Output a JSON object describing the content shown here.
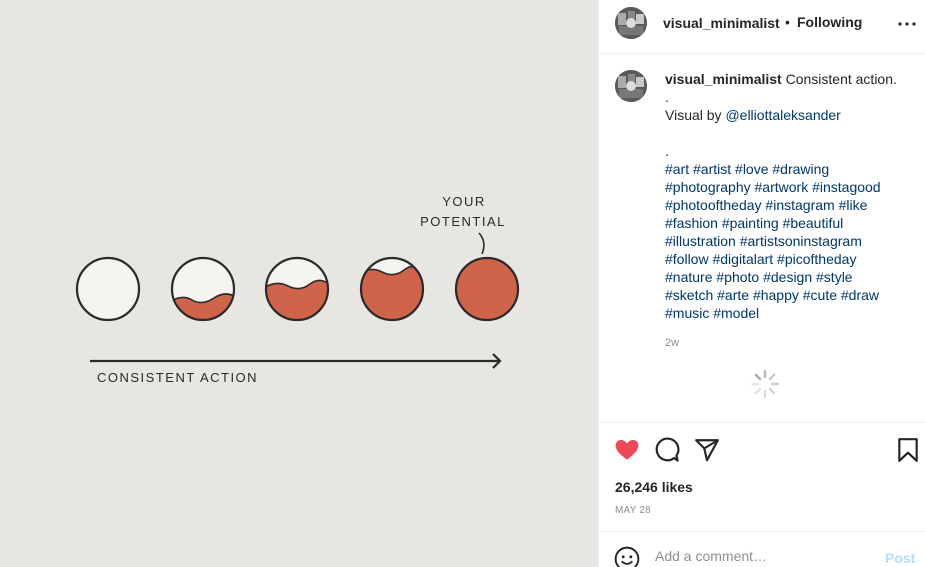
{
  "image": {
    "label_top_line1": "YOUR",
    "label_top_line2": "POTENTIAL",
    "label_bottom": "CONSISTENT ACTION",
    "background_color": "#e8e6e0",
    "fill_color": "#d0644a",
    "stroke_color": "#2a2a2a",
    "circle_fill_levels": [
      0,
      0.32,
      0.5,
      0.75,
      1.0
    ]
  },
  "header": {
    "username": "visual_minimalist",
    "separator": "•",
    "follow_label": "Following",
    "more_icon": "more-options-icon"
  },
  "caption": {
    "username": "visual_minimalist",
    "text": "Consistent action.",
    "line_dot1": ".",
    "credit_prefix": "Visual by ",
    "credit_handle": "@elliottaleksander",
    "line_dot2": ".",
    "hashtags": [
      "#art #artist #love #drawing",
      "#photography #artwork #instagood",
      "#photooftheday #instagram #like",
      "#fashion #painting #beautiful",
      "#illustration #artistsoninstagram",
      "#follow #digitalart #picoftheday",
      "#nature #photo #design #style",
      "#sketch #arte #happy #cute #draw",
      "#music #model"
    ],
    "time": "2w"
  },
  "actions": {
    "like_icon": "heart-filled-icon",
    "comment_icon": "comment-icon",
    "share_icon": "share-icon",
    "save_icon": "bookmark-icon",
    "likes_text": "26,246 likes",
    "date": "MAY 28"
  },
  "comment": {
    "placeholder": "Add a comment…",
    "post_label": "Post",
    "emoji_icon": "emoji-icon"
  },
  "colors": {
    "like_red": "#ed4956",
    "link_blue": "#00376b",
    "post_disabled": "#b2dffc"
  }
}
